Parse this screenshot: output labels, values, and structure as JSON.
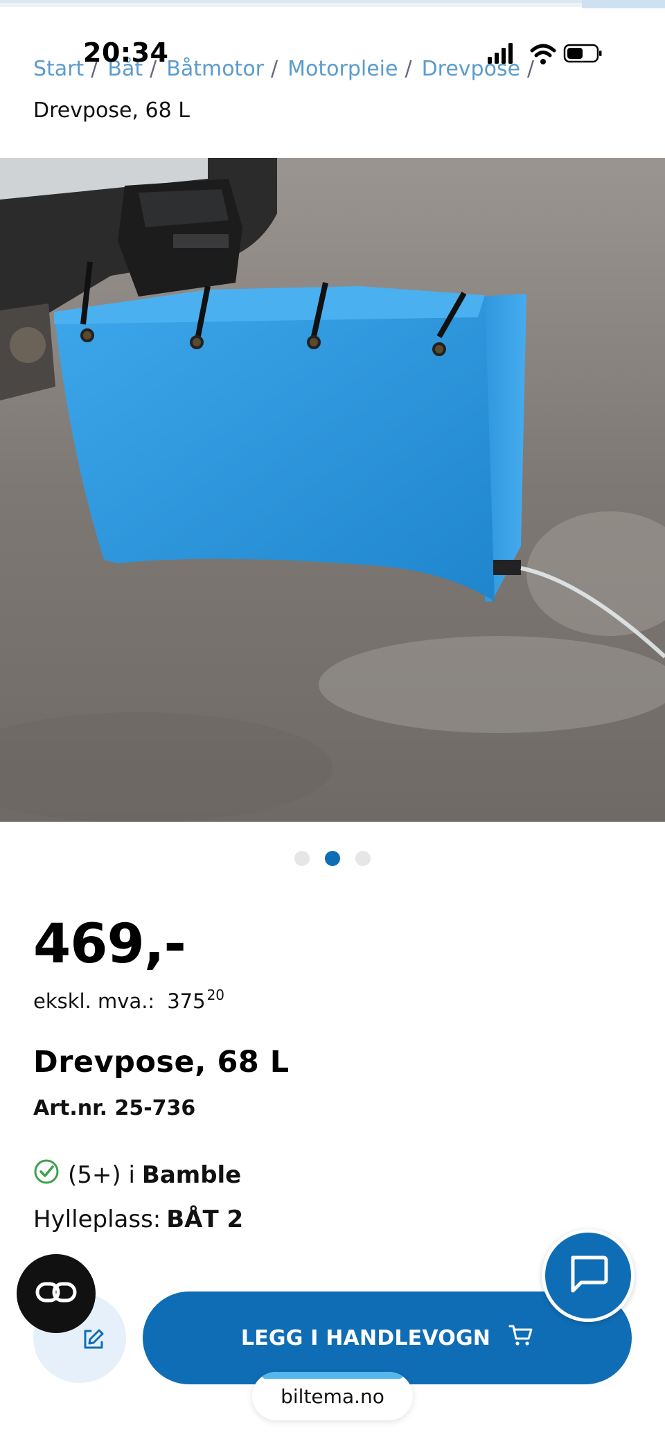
{
  "status_bar": {
    "time": "20:34"
  },
  "breadcrumb": {
    "items": [
      "Start",
      "Båt",
      "Båtmotor",
      "Motorpleie",
      "Drevpose"
    ],
    "separator": "/",
    "current": "Drevpose, 68 L"
  },
  "carousel": {
    "count": 3,
    "active_index": 1
  },
  "product": {
    "price": "469,-",
    "ex_vat_label": "ekskl. mva.:",
    "ex_vat_amount": "375",
    "ex_vat_decimals": "20",
    "title": "Drevpose, 68 L",
    "article_number": "Art.nr. 25-736",
    "stock_count": "(5+) i",
    "stock_store": "Bamble",
    "shelf_label": "Hylleplass:",
    "shelf_value": "BÅT 2"
  },
  "actions": {
    "add_to_cart": "LEGG I HANDLEVOGN"
  },
  "browser": {
    "url": "biltema.no"
  },
  "icons": {
    "chat": "chat-icon",
    "cart": "cart-icon",
    "edit": "edit-icon",
    "overlay": "link-icon",
    "check": "check-circle-icon"
  },
  "colors": {
    "brand_blue": "#0f6db5",
    "breadcrumb_link": "#5b9ccd",
    "stock_green": "#3aa24a",
    "bag_blue": "#2e9be0"
  }
}
